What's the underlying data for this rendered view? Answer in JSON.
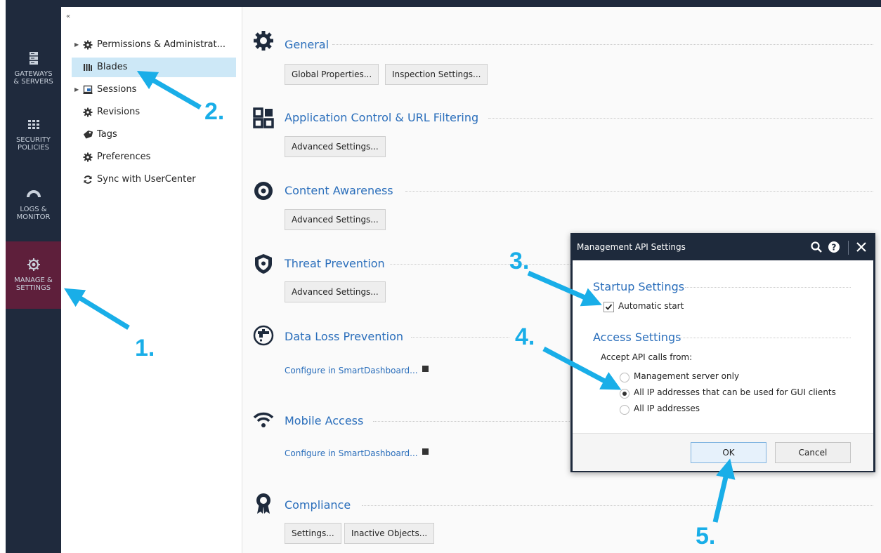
{
  "nav": {
    "items": [
      {
        "label_line1": "GATEWAYS",
        "label_line2": "& SERVERS",
        "icon": "servers-icon"
      },
      {
        "label_line1": "SECURITY",
        "label_line2": "POLICIES",
        "icon": "grid-icon"
      },
      {
        "label_line1": "LOGS &",
        "label_line2": "MONITOR",
        "icon": "gauge-icon"
      },
      {
        "label_line1": "MANAGE &",
        "label_line2": "SETTINGS",
        "icon": "gear-icon"
      }
    ],
    "active": "MANAGE & SETTINGS"
  },
  "tree": {
    "collapse_glyph": "«",
    "items": [
      {
        "label": "Permissions & Administrat...",
        "icon": "gear-icon",
        "expandable": true
      },
      {
        "label": "Blades",
        "icon": "blades-icon",
        "selected": true
      },
      {
        "label": "Sessions",
        "icon": "sessions-icon",
        "expandable": true
      },
      {
        "label": "Revisions",
        "icon": "gear-icon"
      },
      {
        "label": "Tags",
        "icon": "tag-icon"
      },
      {
        "label": "Preferences",
        "icon": "gear-icon"
      },
      {
        "label": "Sync with UserCenter",
        "icon": "sync-icon"
      }
    ]
  },
  "main": {
    "sections": [
      {
        "title": "General",
        "icon": "gear-icon",
        "buttons": [
          "Global Properties...",
          "Inspection Settings..."
        ]
      },
      {
        "title": "Application Control & URL Filtering",
        "icon": "app-grid-icon",
        "buttons": [
          "Advanced Settings..."
        ]
      },
      {
        "title": "Content Awareness",
        "icon": "content-awareness-icon",
        "buttons": [
          "Advanced Settings..."
        ]
      },
      {
        "title": "Threat Prevention",
        "icon": "shield-icon",
        "buttons": [
          "Advanced Settings..."
        ]
      },
      {
        "title": "Data Loss Prevention",
        "icon": "faucet-icon",
        "link": "Configure in SmartDashboard..."
      },
      {
        "title": "Mobile Access",
        "icon": "wifi-icon",
        "link": "Configure in SmartDashboard..."
      },
      {
        "title": "Compliance",
        "icon": "ribbon-icon",
        "buttons": [
          "Settings...",
          "Inactive Objects..."
        ]
      }
    ]
  },
  "dialog": {
    "title": "Management API Settings",
    "startup_heading": "Startup Settings",
    "automatic_start": "Automatic start",
    "automatic_start_checked": true,
    "access_heading": "Access Settings",
    "accept_label": "Accept API calls from:",
    "options": [
      "Management server only",
      "All IP addresses that can be used for GUI clients",
      "All IP addresses"
    ],
    "selected_option": "All IP addresses that can be used for GUI clients",
    "ok": "OK",
    "cancel": "Cancel",
    "title_icons": [
      "search-icon",
      "help-icon",
      "close-icon"
    ]
  },
  "annotations": {
    "steps": [
      "1.",
      "2.",
      "3.",
      "4.",
      "5."
    ],
    "color": "#19aee8"
  },
  "colors": {
    "nav_bg": "#1f2a3d",
    "nav_active": "#5e1f3b",
    "accent": "#2a6ebb",
    "tree_selected": "#cde8f7"
  }
}
